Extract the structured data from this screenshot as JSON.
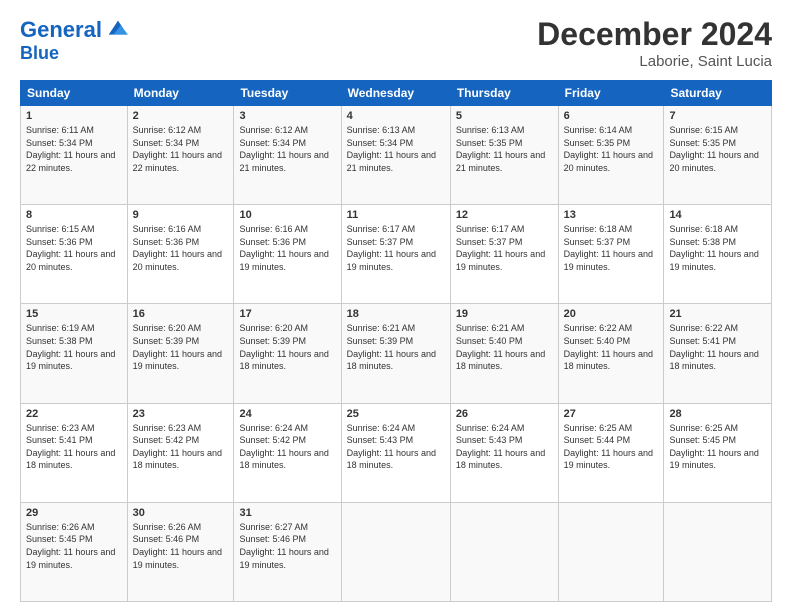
{
  "header": {
    "logo_line1": "General",
    "logo_line2": "Blue",
    "month": "December 2024",
    "location": "Laborie, Saint Lucia"
  },
  "weekdays": [
    "Sunday",
    "Monday",
    "Tuesday",
    "Wednesday",
    "Thursday",
    "Friday",
    "Saturday"
  ],
  "weeks": [
    [
      {
        "day": "1",
        "sunrise": "Sunrise: 6:11 AM",
        "sunset": "Sunset: 5:34 PM",
        "daylight": "Daylight: 11 hours and 22 minutes."
      },
      {
        "day": "2",
        "sunrise": "Sunrise: 6:12 AM",
        "sunset": "Sunset: 5:34 PM",
        "daylight": "Daylight: 11 hours and 22 minutes."
      },
      {
        "day": "3",
        "sunrise": "Sunrise: 6:12 AM",
        "sunset": "Sunset: 5:34 PM",
        "daylight": "Daylight: 11 hours and 21 minutes."
      },
      {
        "day": "4",
        "sunrise": "Sunrise: 6:13 AM",
        "sunset": "Sunset: 5:34 PM",
        "daylight": "Daylight: 11 hours and 21 minutes."
      },
      {
        "day": "5",
        "sunrise": "Sunrise: 6:13 AM",
        "sunset": "Sunset: 5:35 PM",
        "daylight": "Daylight: 11 hours and 21 minutes."
      },
      {
        "day": "6",
        "sunrise": "Sunrise: 6:14 AM",
        "sunset": "Sunset: 5:35 PM",
        "daylight": "Daylight: 11 hours and 20 minutes."
      },
      {
        "day": "7",
        "sunrise": "Sunrise: 6:15 AM",
        "sunset": "Sunset: 5:35 PM",
        "daylight": "Daylight: 11 hours and 20 minutes."
      }
    ],
    [
      {
        "day": "8",
        "sunrise": "Sunrise: 6:15 AM",
        "sunset": "Sunset: 5:36 PM",
        "daylight": "Daylight: 11 hours and 20 minutes."
      },
      {
        "day": "9",
        "sunrise": "Sunrise: 6:16 AM",
        "sunset": "Sunset: 5:36 PM",
        "daylight": "Daylight: 11 hours and 20 minutes."
      },
      {
        "day": "10",
        "sunrise": "Sunrise: 6:16 AM",
        "sunset": "Sunset: 5:36 PM",
        "daylight": "Daylight: 11 hours and 19 minutes."
      },
      {
        "day": "11",
        "sunrise": "Sunrise: 6:17 AM",
        "sunset": "Sunset: 5:37 PM",
        "daylight": "Daylight: 11 hours and 19 minutes."
      },
      {
        "day": "12",
        "sunrise": "Sunrise: 6:17 AM",
        "sunset": "Sunset: 5:37 PM",
        "daylight": "Daylight: 11 hours and 19 minutes."
      },
      {
        "day": "13",
        "sunrise": "Sunrise: 6:18 AM",
        "sunset": "Sunset: 5:37 PM",
        "daylight": "Daylight: 11 hours and 19 minutes."
      },
      {
        "day": "14",
        "sunrise": "Sunrise: 6:18 AM",
        "sunset": "Sunset: 5:38 PM",
        "daylight": "Daylight: 11 hours and 19 minutes."
      }
    ],
    [
      {
        "day": "15",
        "sunrise": "Sunrise: 6:19 AM",
        "sunset": "Sunset: 5:38 PM",
        "daylight": "Daylight: 11 hours and 19 minutes."
      },
      {
        "day": "16",
        "sunrise": "Sunrise: 6:20 AM",
        "sunset": "Sunset: 5:39 PM",
        "daylight": "Daylight: 11 hours and 19 minutes."
      },
      {
        "day": "17",
        "sunrise": "Sunrise: 6:20 AM",
        "sunset": "Sunset: 5:39 PM",
        "daylight": "Daylight: 11 hours and 18 minutes."
      },
      {
        "day": "18",
        "sunrise": "Sunrise: 6:21 AM",
        "sunset": "Sunset: 5:39 PM",
        "daylight": "Daylight: 11 hours and 18 minutes."
      },
      {
        "day": "19",
        "sunrise": "Sunrise: 6:21 AM",
        "sunset": "Sunset: 5:40 PM",
        "daylight": "Daylight: 11 hours and 18 minutes."
      },
      {
        "day": "20",
        "sunrise": "Sunrise: 6:22 AM",
        "sunset": "Sunset: 5:40 PM",
        "daylight": "Daylight: 11 hours and 18 minutes."
      },
      {
        "day": "21",
        "sunrise": "Sunrise: 6:22 AM",
        "sunset": "Sunset: 5:41 PM",
        "daylight": "Daylight: 11 hours and 18 minutes."
      }
    ],
    [
      {
        "day": "22",
        "sunrise": "Sunrise: 6:23 AM",
        "sunset": "Sunset: 5:41 PM",
        "daylight": "Daylight: 11 hours and 18 minutes."
      },
      {
        "day": "23",
        "sunrise": "Sunrise: 6:23 AM",
        "sunset": "Sunset: 5:42 PM",
        "daylight": "Daylight: 11 hours and 18 minutes."
      },
      {
        "day": "24",
        "sunrise": "Sunrise: 6:24 AM",
        "sunset": "Sunset: 5:42 PM",
        "daylight": "Daylight: 11 hours and 18 minutes."
      },
      {
        "day": "25",
        "sunrise": "Sunrise: 6:24 AM",
        "sunset": "Sunset: 5:43 PM",
        "daylight": "Daylight: 11 hours and 18 minutes."
      },
      {
        "day": "26",
        "sunrise": "Sunrise: 6:24 AM",
        "sunset": "Sunset: 5:43 PM",
        "daylight": "Daylight: 11 hours and 18 minutes."
      },
      {
        "day": "27",
        "sunrise": "Sunrise: 6:25 AM",
        "sunset": "Sunset: 5:44 PM",
        "daylight": "Daylight: 11 hours and 19 minutes."
      },
      {
        "day": "28",
        "sunrise": "Sunrise: 6:25 AM",
        "sunset": "Sunset: 5:45 PM",
        "daylight": "Daylight: 11 hours and 19 minutes."
      }
    ],
    [
      {
        "day": "29",
        "sunrise": "Sunrise: 6:26 AM",
        "sunset": "Sunset: 5:45 PM",
        "daylight": "Daylight: 11 hours and 19 minutes."
      },
      {
        "day": "30",
        "sunrise": "Sunrise: 6:26 AM",
        "sunset": "Sunset: 5:46 PM",
        "daylight": "Daylight: 11 hours and 19 minutes."
      },
      {
        "day": "31",
        "sunrise": "Sunrise: 6:27 AM",
        "sunset": "Sunset: 5:46 PM",
        "daylight": "Daylight: 11 hours and 19 minutes."
      },
      null,
      null,
      null,
      null
    ]
  ]
}
